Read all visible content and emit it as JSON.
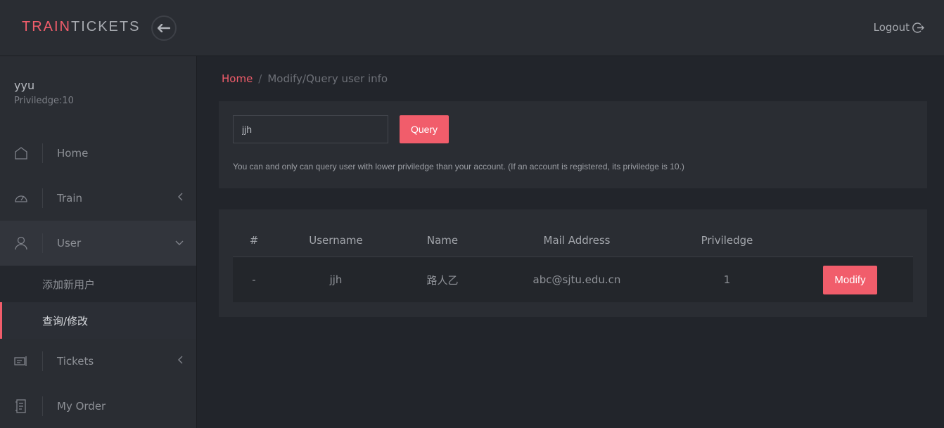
{
  "header": {
    "brand_part1": "TRAIN",
    "brand_part2": "TICKETS",
    "logout_label": "Logout"
  },
  "sidebar": {
    "user_name": "yyu",
    "user_privilege": "Priviledge:10",
    "items": [
      {
        "label": "Home",
        "icon": "home-icon"
      },
      {
        "label": "Train",
        "icon": "gauge-icon"
      },
      {
        "label": "User",
        "icon": "user-icon"
      },
      {
        "label": "Tickets",
        "icon": "ticket-icon"
      },
      {
        "label": "My Order",
        "icon": "order-icon"
      }
    ],
    "user_subitems": [
      {
        "label": "添加新用户"
      },
      {
        "label": "查询/修改"
      }
    ]
  },
  "breadcrumb": {
    "home": "Home",
    "separator": "/",
    "current": "Modify/Query user info"
  },
  "query": {
    "input_value": "jjh",
    "button_label": "Query",
    "hint": "You can and only can query user with lower priviledge than your account. (If an account is registered, its priviledge is 10.)"
  },
  "table": {
    "headers": [
      "#",
      "Username",
      "Name",
      "Mail Address",
      "Priviledge"
    ],
    "rows": [
      {
        "index": "-",
        "username": "jjh",
        "name": "路人乙",
        "mail": "abc@sjtu.edu.cn",
        "privilege": "1",
        "action": "Modify"
      }
    ]
  },
  "colors": {
    "accent": "#f15d6b",
    "background": "#22252b",
    "panel": "#2a2d33"
  }
}
